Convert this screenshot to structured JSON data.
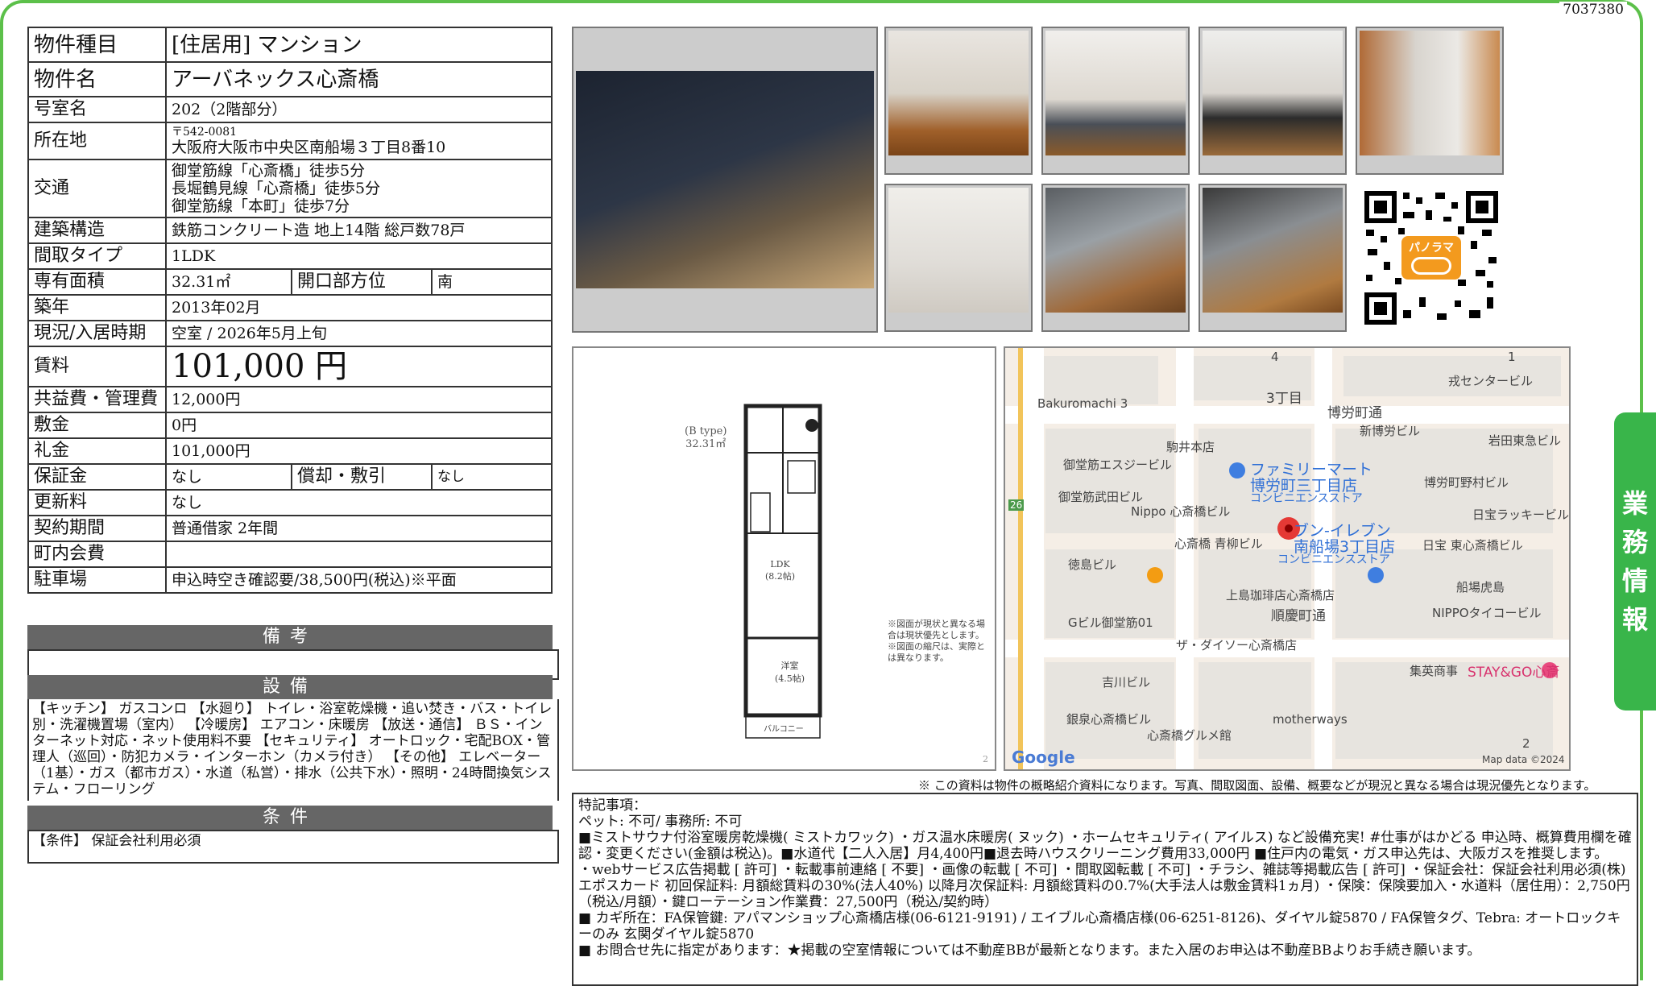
{
  "doc_no": "7037380",
  "side_tab": "業務情報",
  "spec": {
    "rows": [
      {
        "label": "物件種目",
        "value": "[住居用] マンション"
      },
      {
        "label": "物件名",
        "value": "アーバネックス心斎橋"
      },
      {
        "label": "号室名",
        "value": "202（2階部分）"
      },
      {
        "label": "所在地",
        "zip": "〒542-0081",
        "value": "大阪府大阪市中央区南船場３丁目8番10"
      },
      {
        "label": "交通",
        "lines": [
          "御堂筋線「心斎橋」徒歩5分",
          "長堀鶴見線「心斎橋」徒歩5分",
          "御堂筋線「本町」徒歩7分"
        ]
      },
      {
        "label": "建築構造",
        "value": "鉄筋コンクリート造 地上14階 総戸数78戸"
      },
      {
        "label": "間取タイプ",
        "value": "1LDK"
      },
      {
        "label": "専有面積",
        "value": "32.31㎡",
        "label2": "開口部方位",
        "value2": "南"
      },
      {
        "label": "築年",
        "value": "2013年02月"
      },
      {
        "label": "現況/入居時期",
        "value": "空室 /  2026年5月上旬"
      },
      {
        "label": "賃料",
        "value": "101,000 円"
      },
      {
        "label": "共益費・管理費",
        "value": "12,000円"
      },
      {
        "label": "敷金",
        "value": "0円"
      },
      {
        "label": "礼金",
        "value": "101,000円"
      },
      {
        "label": "保証金",
        "value": "なし",
        "label2": "償却・敷引",
        "value2": "なし"
      },
      {
        "label": "更新料",
        "value": "なし"
      },
      {
        "label": "契約期間",
        "value": "普通借家 2年間"
      },
      {
        "label": "町内会費",
        "value": ""
      },
      {
        "label": "駐車場",
        "value": "申込時空き確認要/38,500円(税込)※平面"
      }
    ]
  },
  "sections": {
    "biko": "備考",
    "setsubi": "設備",
    "jouken": "条件"
  },
  "setsubi_text": "【キッチン】 ガスコンロ 【水廻り】 トイレ・浴室乾燥機・追い焚き・バス・トイレ別・洗濯機置場（室内） 【冷暖房】 エアコン・床暖房 【放送・通信】 ＢＳ・インターネット対応・ネット使用料不要 【セキュリティ】 オートロック・宅配BOX・管理人（巡回）・防犯カメラ・インターホン（カメラ付き） 【その他】 エレベーター（1基）・ガス（都市ガス）・水道（私営）・排水（公共下水）・照明・24時間換気システム・フローリング",
  "jouken_text": "【条件】 保証会社利用必須",
  "qr_label": "パノラマ",
  "plan": {
    "type": "(B type)",
    "area": "32.31㎡",
    "ldk": "LDK\n(8.2帖)",
    "yoshitsu": "洋室\n(4.5帖)",
    "balcony": "バルコニー",
    "note1": "※図面が現状と異なる場合は現状優先とします。",
    "note2": "※図面の縮尺は、実際とは異なります。",
    "page": "2"
  },
  "map": {
    "labels": [
      {
        "t": "Bakuromachi 3"
      },
      {
        "t": "3丁目"
      },
      {
        "t": "博労町通"
      },
      {
        "t": "戎センタービル"
      },
      {
        "t": "駒井本店"
      },
      {
        "t": "新博労ビル"
      },
      {
        "t": "岩田東急ビル"
      },
      {
        "t": "御堂筋エスジービル"
      },
      {
        "t": "ファミリーマート"
      },
      {
        "t": "博労町三丁目店"
      },
      {
        "t": "コンビニエンスストア"
      },
      {
        "t": "博労町野村ビル"
      },
      {
        "t": "御堂筋武田ビル"
      },
      {
        "t": "Nippo 心斎橋ビル"
      },
      {
        "t": "日宝ラッキービル"
      },
      {
        "t": "ブン-イレブン"
      },
      {
        "t": "南船場3丁目店"
      },
      {
        "t": "コンビニエンスストア"
      },
      {
        "t": "心斎橋 青柳ビル"
      },
      {
        "t": "日宝 東心斎橋ビル"
      },
      {
        "t": "徳島ビル"
      },
      {
        "t": "上島珈琲店心斎橋店"
      },
      {
        "t": "船場虎島"
      },
      {
        "t": "Gビル御堂筋01"
      },
      {
        "t": "順慶町通"
      },
      {
        "t": "NIPPOタイコービル"
      },
      {
        "t": "ザ・ダイソー心斎橋店"
      },
      {
        "t": "集英商事"
      },
      {
        "t": "STAY&GO心斎"
      },
      {
        "t": "吉川ビル"
      },
      {
        "t": "銀泉心斎橋ビル"
      },
      {
        "t": "motherways"
      },
      {
        "t": "心斎橋グルメ館"
      },
      {
        "t": "Google"
      },
      {
        "t": "Map data ©2024"
      },
      {
        "t": "4"
      },
      {
        "t": "1"
      },
      {
        "t": "2"
      },
      {
        "t": "26"
      }
    ]
  },
  "notice": "※ この資料は物件の概略紹介資料になります。写真、間取図面、設備、概要などが現況と異なる場合は現況優先となります。",
  "remarks": [
    "特記事項：",
    "ペット: 不可/ 事務所: 不可",
    "■ミストサウナ付浴室暖房乾燥機( ミストカワック) ・ガス温水床暖房( ヌック) ・ホームセキュリティ( アイルス) など設備充実! #仕事がはかどる 申込時、概算費用欄を確認・変更ください(金額は税込)。■水道代【二人入居】月4,400円■退去時ハウスクリーニング費用33,000円 ■住戸内の電気・ガス申込先は、大阪ガスを推奨します。",
    "・webサービス広告掲載 [ 許可] ・転載事前連絡 [ 不要] ・画像の転載 [ 不可] ・間取図転載 [ 不可] ・チラシ、雑誌等掲載広告 [ 許可] ・保証会社：保証会社利用必須(株)エポスカード 初回保証料: 月額総賃料の30%(法人40%) 以降月次保証料: 月額総賃料の0.7%(大手法人は敷金賃料1ヵ月) ・保険：保険要加入・水道料（居住用）：2,750円（税込/月額）・鍵ローテーション作業費：27,500円（税込/契約時）",
    "■ カギ所在：FA保管鍵: アパマンショップ心斎橋店様(06-6121-9191) / エイブル心斎橋店様(06-6251-8126)、ダイヤル錠5870 / FA保管タグ、Tebra: オートロックキーのみ 玄関ダイヤル錠5870",
    "■ お問合せ先に指定があります：★掲載の空室情報については不動産BBが最新となります。また入居のお申込は不動産BBよりお手続き願います。"
  ]
}
